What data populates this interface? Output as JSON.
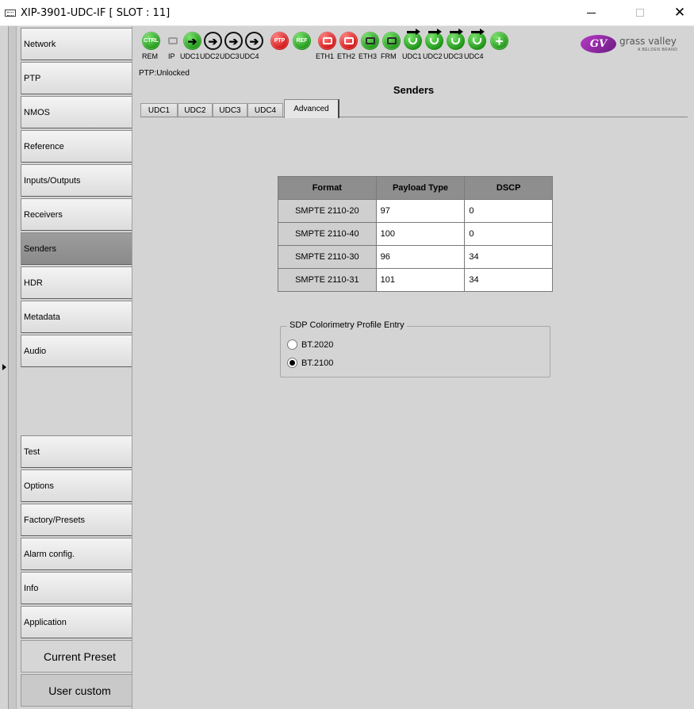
{
  "window": {
    "title": "XIP-3901-UDC-IF [ SLOT : 11]",
    "minimize_label": "",
    "maximize_label": "",
    "close_label": "✕"
  },
  "sidebar": {
    "items": [
      {
        "label": "Network",
        "active": false
      },
      {
        "label": "PTP",
        "active": false
      },
      {
        "label": "NMOS",
        "active": false
      },
      {
        "label": "Reference",
        "active": false
      },
      {
        "label": "Inputs/Outputs",
        "active": false
      },
      {
        "label": "Receivers",
        "active": false
      },
      {
        "label": "Senders",
        "active": true
      },
      {
        "label": "HDR",
        "active": false
      },
      {
        "label": "Metadata",
        "active": false
      },
      {
        "label": "Audio",
        "active": false
      }
    ],
    "lower_items": [
      {
        "label": "Test"
      },
      {
        "label": "Options"
      },
      {
        "label": "Factory/Presets"
      },
      {
        "label": "Alarm config."
      },
      {
        "label": "Info"
      },
      {
        "label": "Application"
      }
    ],
    "current_preset_label": "Current Preset",
    "user_custom_label": "User custom"
  },
  "status_bar": {
    "icons": [
      {
        "label": "REM",
        "icon": "ctrl-icon",
        "text": "CTRL",
        "color": "#1f9618"
      },
      {
        "label": "IP",
        "icon": "network-icon",
        "text": "",
        "color": "#d4d4d4"
      },
      {
        "label": "UDC1",
        "icon": "input-arrow-icon",
        "text": "",
        "color": "#1f9618"
      },
      {
        "label": "UDC2",
        "icon": "input-arrow-icon",
        "text": "",
        "color": "#d4d4d4"
      },
      {
        "label": "UDC3",
        "icon": "input-arrow-icon",
        "text": "",
        "color": "#d4d4d4"
      },
      {
        "label": "UDC4",
        "icon": "input-arrow-icon",
        "text": "",
        "color": "#d4d4d4"
      },
      {
        "label": "",
        "icon": "ptp-icon",
        "text": "PTP",
        "color": "#d11414"
      },
      {
        "label": "",
        "icon": "ref-icon",
        "text": "REF",
        "color": "#1f9618"
      },
      {
        "label": "ETH1",
        "icon": "ethernet-icon",
        "text": "",
        "color": "#d11414"
      },
      {
        "label": "ETH2",
        "icon": "ethernet-icon",
        "text": "",
        "color": "#d11414"
      },
      {
        "label": "ETH3",
        "icon": "ethernet-icon",
        "text": "",
        "color": "#1f9618"
      },
      {
        "label": "FRM",
        "icon": "frame-icon",
        "text": "",
        "color": "#1f9618"
      },
      {
        "label": "UDC1",
        "icon": "output-icon",
        "text": "",
        "color": "#1f9618"
      },
      {
        "label": "UDC2",
        "icon": "output-icon",
        "text": "",
        "color": "#1f9618"
      },
      {
        "label": "UDC3",
        "icon": "output-icon",
        "text": "",
        "color": "#1f9618"
      },
      {
        "label": "UDC4",
        "icon": "output-icon",
        "text": "",
        "color": "#1f9618"
      },
      {
        "label": "",
        "icon": "plus-icon",
        "text": "+",
        "color": "#1f9618"
      }
    ],
    "brand_name": "grass valley",
    "brand_sub": "A BELDEN BRAND",
    "brand_mark": "GV"
  },
  "main": {
    "ptp_status": "PTP:Unlocked",
    "section_title": "Senders",
    "tabs": [
      {
        "label": "UDC1",
        "active": false
      },
      {
        "label": "UDC2",
        "active": false
      },
      {
        "label": "UDC3",
        "active": false
      },
      {
        "label": "UDC4",
        "active": false
      },
      {
        "label": "Advanced",
        "active": true
      }
    ],
    "table": {
      "headers": [
        "Format",
        "Payload Type",
        "DSCP"
      ],
      "rows": [
        [
          "SMPTE 2110-20",
          "97",
          "0"
        ],
        [
          "SMPTE 2110-40",
          "100",
          "0"
        ],
        [
          "SMPTE 2110-30",
          "96",
          "34"
        ],
        [
          "SMPTE 2110-31",
          "101",
          "34"
        ]
      ]
    },
    "colorimetry": {
      "legend": "SDP Colorimetry Profile Entry",
      "options": [
        {
          "label": "BT.2020",
          "selected": false
        },
        {
          "label": "BT.2100",
          "selected": true
        }
      ]
    }
  },
  "colors": {
    "panel_bg": "#d4d4d4",
    "active_nav": "#8e8e8e",
    "table_header": "#8e8e8e",
    "status_green": "#1f9618",
    "status_red": "#d11414"
  }
}
